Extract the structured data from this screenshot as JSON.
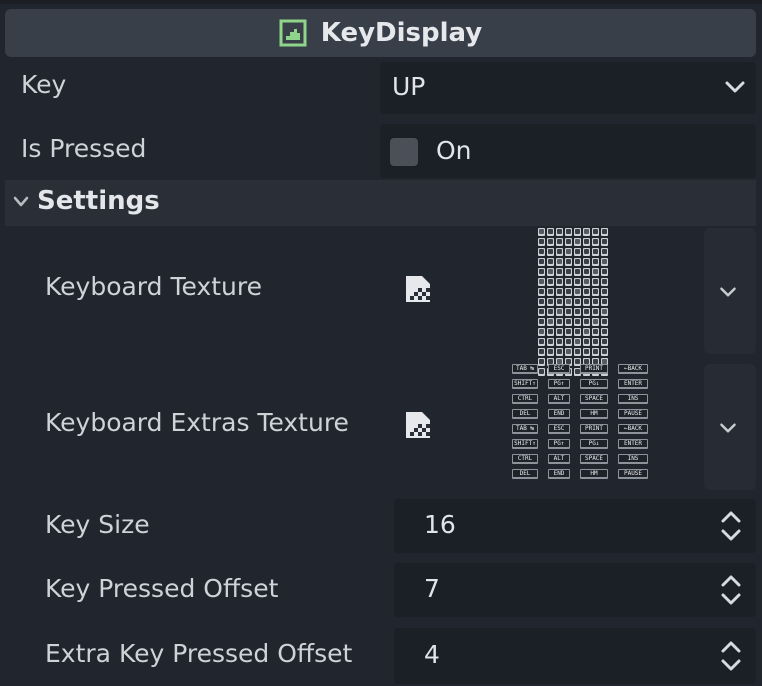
{
  "header": {
    "title": "KeyDisplay",
    "icon": "node-icon",
    "accent": "#8ed48a"
  },
  "properties": {
    "key": {
      "label": "Key",
      "value": "UP"
    },
    "is_pressed": {
      "label": "Is Pressed",
      "value": "On",
      "checked": false
    }
  },
  "settings": {
    "title": "Settings",
    "keyboard_texture": {
      "label": "Keyboard Texture"
    },
    "keyboard_extras_texture": {
      "label": "Keyboard Extras Texture",
      "keys": [
        "TAB ↹",
        "ESC",
        "PRINT",
        "←BACK",
        "SHIFT↑",
        "PG↑",
        "PG↓",
        "ENTER",
        "CTRL",
        "ALT",
        "SPACE",
        "INS",
        "DEL",
        "END",
        "HM",
        "PAUSE",
        "TAB ↹",
        "ESC",
        "PRINT",
        "←BACK",
        "SHIFT↑",
        "PG↑",
        "PG↓",
        "ENTER",
        "CTRL",
        "ALT",
        "SPACE",
        "INS",
        "DEL",
        "END",
        "HM",
        "PAUSE"
      ]
    },
    "key_size": {
      "label": "Key Size",
      "value": "16"
    },
    "key_pressed_offset": {
      "label": "Key Pressed Offset",
      "value": "7"
    },
    "extra_key_pressed_offset": {
      "label": "Extra Key Pressed Offset",
      "value": "4"
    }
  }
}
